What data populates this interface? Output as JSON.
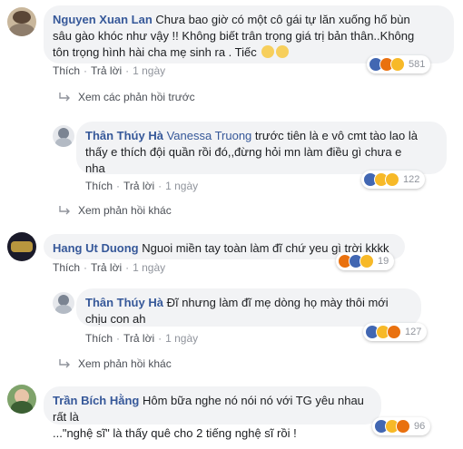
{
  "comments": [
    {
      "author": "Nguyen Xuan Lan",
      "text1": "Chưa bao giờ có một cô gái tự lăn xuống hố bùn",
      "text2": "sâu gào khóc như vậy !! Không biết trân trọng giá trị bản thân..Không",
      "text3": "tôn trọng hình hài cha mẹ sinh ra . Tiếc",
      "like": "Thích",
      "reply": "Trả lời",
      "time": "1 ngày",
      "reaction_count": "581"
    },
    {
      "author": "Thân Thúy Hà",
      "mention": "Vanessa Truong",
      "text1": "trước tiên là e vô cmt tào lao là",
      "text2": "thấy e thích đội quần rồi đó,,đừng hỏi mn làm điều gì chưa e",
      "text3": "nha",
      "like": "Thích",
      "reply": "Trả lời",
      "time": "1 ngày",
      "reaction_count": "122"
    },
    {
      "author": "Hang Ut Duong",
      "text1": "Nguoi miền tay toàn làm đĩ chứ yeu gì trời kkkk",
      "like": "Thích",
      "reply": "Trả lời",
      "time": "1 ngày",
      "reaction_count": "19"
    },
    {
      "author": "Thân Thúy Hà",
      "text1": "Đĩ nhưng làm đĩ mẹ dòng họ mày thôi mới",
      "text2": "chịu con ah",
      "like": "Thích",
      "reply": "Trả lời",
      "time": "1 ngày",
      "reaction_count": "127"
    },
    {
      "author": "Trần Bích Hằng",
      "text1": "Hôm bữa nghe nó nói nó với TG yêu nhau rất là",
      "text2": "...\"nghệ sĩ\" là thấy quê cho 2 tiếng nghệ sĩ rồi !",
      "reaction_count": "96"
    }
  ],
  "links": {
    "previous_replies": "Xem các phản hồi trước",
    "other_replies_1": "Xem phản hồi khác",
    "other_replies_2": "Xem phản hồi khác"
  },
  "colors": {
    "author": "#365899",
    "bubble": "#f2f3f5",
    "like": "#4267b2",
    "haha": "#f7b928",
    "angry": "#e9710f"
  }
}
